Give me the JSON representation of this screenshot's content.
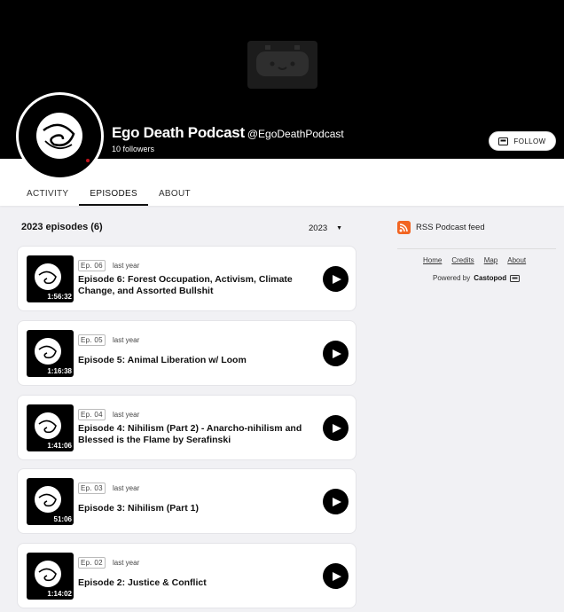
{
  "header": {
    "title": "Ego Death Podcast",
    "handle": "@EgoDeathPodcast",
    "followers": "10 followers",
    "follow_label": "FOLLOW",
    "banner_icon": "castopod-mascot-icon"
  },
  "tabs": [
    {
      "label": "ACTIVITY",
      "active": false
    },
    {
      "label": "EPISODES",
      "active": true
    },
    {
      "label": "ABOUT",
      "active": false
    }
  ],
  "episodes_section": {
    "heading": "2023 episodes (6)",
    "year": "2023"
  },
  "episodes": [
    {
      "number": "Ep. 06",
      "date": "last year",
      "title": "Episode 6: Forest Occupation, Activism, Climate Change, and Assorted Bullshit",
      "duration": "1:56:32"
    },
    {
      "number": "Ep. 05",
      "date": "last year",
      "title": "Episode 5: Animal Liberation w/ Loom",
      "duration": "1:16:38"
    },
    {
      "number": "Ep. 04",
      "date": "last year",
      "title": "Episode 4: Nihilism (Part 2) - Anarcho-nihilism and Blessed is the Flame by Serafinski",
      "duration": "1:41:06"
    },
    {
      "number": "Ep. 03",
      "date": "last year",
      "title": "Episode 3: Nihilism (Part 1)",
      "duration": "51:06"
    },
    {
      "number": "Ep. 02",
      "date": "last year",
      "title": "Episode 2: Justice & Conflict",
      "duration": "1:14:02"
    }
  ],
  "sidebar": {
    "rss_label": "RSS Podcast feed",
    "links": [
      "Home",
      "Credits",
      "Map",
      "About"
    ],
    "powered_by": "Powered by",
    "powered_brand": "Castopod"
  },
  "colors": {
    "banner": "#000000",
    "rss": "#f26522",
    "page_bg": "#f1f1f4"
  }
}
